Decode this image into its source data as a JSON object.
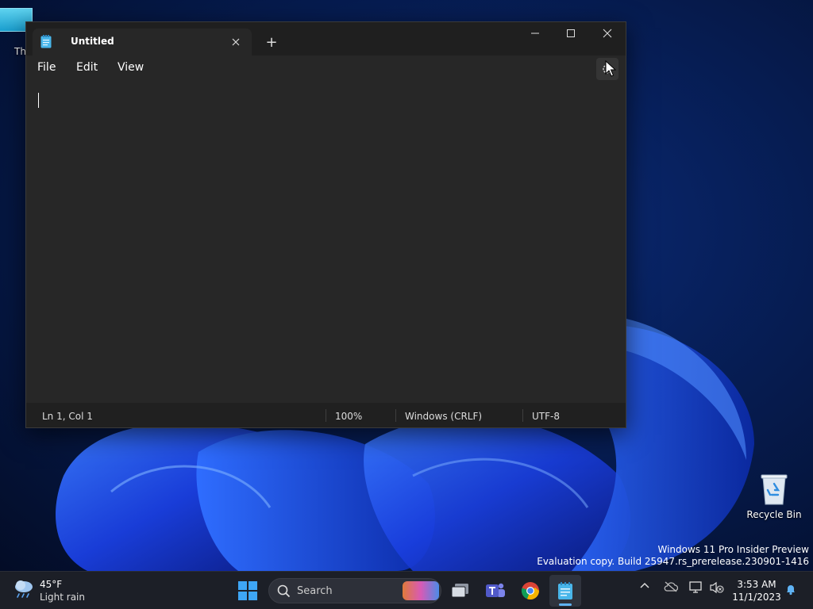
{
  "desktop": {
    "icons": [
      {
        "label": "Th"
      },
      {
        "label": "Recycle Bin"
      }
    ],
    "watermark": {
      "line1": "Windows 11 Pro Insider Preview",
      "line2": "Evaluation copy. Build 25947.rs_prerelease.230901-1416"
    }
  },
  "window": {
    "tab_title": "Untitled",
    "new_tab_symbol": "+",
    "menu": {
      "file": "File",
      "edit": "Edit",
      "view": "View"
    },
    "status": {
      "position": "Ln 1, Col 1",
      "zoom": "100%",
      "line_ending": "Windows (CRLF)",
      "encoding": "UTF-8"
    },
    "icons": {
      "app": "notepad-icon",
      "close_tab": "close-icon",
      "minimize": "minimize-icon",
      "maximize": "maximize-icon",
      "close": "close-icon",
      "settings": "gear-icon"
    }
  },
  "taskbar": {
    "weather": {
      "temp": "45°F",
      "condition": "Light rain"
    },
    "search_placeholder": "Search",
    "clock": {
      "time": "3:53 AM",
      "date": "11/1/2023"
    }
  },
  "colors": {
    "window_bg": "#272727",
    "titlebar_bg": "#1f1f1f",
    "statusbar_bg": "#202020",
    "taskbar_bg": "#1c1f27",
    "accent": "#5fb3f5"
  }
}
